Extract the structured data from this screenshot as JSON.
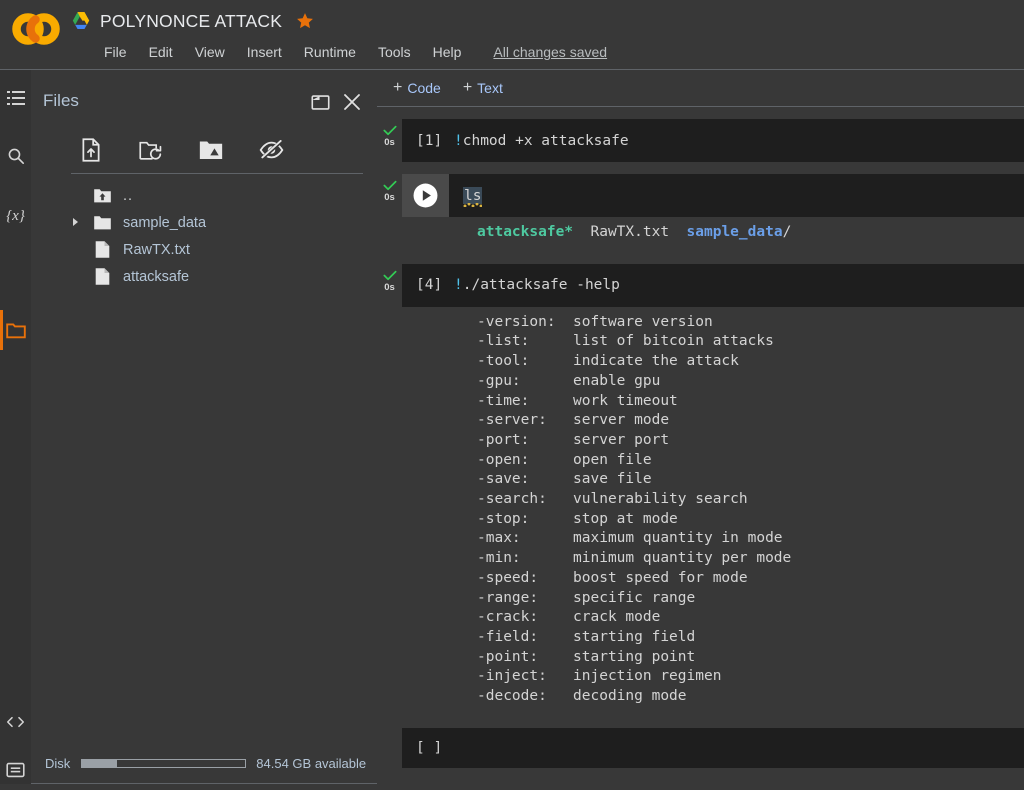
{
  "app": {
    "logo_icon": "colab-co-logo",
    "drive_icon": "google-drive-icon",
    "star_icon": "star-icon",
    "notebook_title": "POLYNONCE ATTACK",
    "save_status": "All changes saved"
  },
  "menubar": {
    "items": [
      {
        "label": "File"
      },
      {
        "label": "Edit"
      },
      {
        "label": "View"
      },
      {
        "label": "Insert"
      },
      {
        "label": "Runtime"
      },
      {
        "label": "Tools"
      },
      {
        "label": "Help"
      }
    ]
  },
  "rail": {
    "items": [
      {
        "name": "table-of-contents-icon",
        "active": false
      },
      {
        "name": "search-icon",
        "active": false
      },
      {
        "name": "variables-icon",
        "active": false,
        "glyph": "{x}"
      },
      {
        "name": "files-folder-icon",
        "active": true
      }
    ],
    "bottom_items": [
      {
        "name": "code-snippets-icon"
      },
      {
        "name": "terminal-icon"
      }
    ],
    "active_color": "#e8710a"
  },
  "files_panel": {
    "title": "Files",
    "popout_button": "open-in-new-window",
    "close_button": "close-panel",
    "toolbar": [
      {
        "name": "upload-file-icon",
        "tooltip": "Upload to session storage"
      },
      {
        "name": "refresh-folder-icon",
        "tooltip": "Refresh"
      },
      {
        "name": "mount-drive-icon",
        "tooltip": "Mount Drive"
      },
      {
        "name": "toggle-hidden-files-icon",
        "tooltip": "Show hidden files"
      }
    ],
    "entries": [
      {
        "label": "..",
        "kind": "parent",
        "icon": "folder-up-icon",
        "expandable": false
      },
      {
        "label": "sample_data",
        "kind": "folder",
        "icon": "folder-icon",
        "expandable": true
      },
      {
        "label": "RawTX.txt",
        "kind": "file",
        "icon": "file-icon",
        "expandable": false
      },
      {
        "label": "attacksafe",
        "kind": "file",
        "icon": "file-icon",
        "expandable": false
      }
    ],
    "disk": {
      "label": "Disk",
      "available_text": "84.54 GB available",
      "used_percent": 21
    }
  },
  "notebook": {
    "toolbar": {
      "add_code_label": "Code",
      "add_text_label": "Text",
      "plus": "+"
    },
    "cells": [
      {
        "exec_count": "[1]",
        "status_icon": "check-icon",
        "runtime": "0s",
        "code_prefix": "!",
        "code": "chmod +x attacksafe",
        "has_run_button": false,
        "selected": false,
        "output_lines": []
      },
      {
        "exec_count": "",
        "status_icon": "check-icon",
        "runtime": "0s",
        "code_prefix": "",
        "code": "ls",
        "has_run_button": true,
        "selected": true,
        "output_lines": [
          {
            "segments": [
              {
                "text": "attacksafe*",
                "style": "green"
              },
              {
                "text": "  RawTX.txt  ",
                "style": "plain"
              },
              {
                "text": "sample_data",
                "style": "blue"
              },
              {
                "text": "/",
                "style": "plain"
              }
            ]
          }
        ]
      },
      {
        "exec_count": "[4]",
        "status_icon": "check-icon",
        "runtime": "0s",
        "code_prefix": "!",
        "code": "./attacksafe -help",
        "has_run_button": false,
        "selected": false,
        "output_lines": [
          {
            "segments": [
              {
                "text": "-version:  software version",
                "style": "plain"
              }
            ]
          },
          {
            "segments": [
              {
                "text": "-list:     list of bitcoin attacks",
                "style": "plain"
              }
            ]
          },
          {
            "segments": [
              {
                "text": "-tool:     indicate the attack",
                "style": "plain"
              }
            ]
          },
          {
            "segments": [
              {
                "text": "-gpu:      enable gpu",
                "style": "plain"
              }
            ]
          },
          {
            "segments": [
              {
                "text": "-time:     work timeout",
                "style": "plain"
              }
            ]
          },
          {
            "segments": [
              {
                "text": "-server:   server mode",
                "style": "plain"
              }
            ]
          },
          {
            "segments": [
              {
                "text": "-port:     server port",
                "style": "plain"
              }
            ]
          },
          {
            "segments": [
              {
                "text": "-open:     open file",
                "style": "plain"
              }
            ]
          },
          {
            "segments": [
              {
                "text": "-save:     save file",
                "style": "plain"
              }
            ]
          },
          {
            "segments": [
              {
                "text": "-search:   vulnerability search",
                "style": "plain"
              }
            ]
          },
          {
            "segments": [
              {
                "text": "-stop:     stop at mode",
                "style": "plain"
              }
            ]
          },
          {
            "segments": [
              {
                "text": "-max:      maximum quantity in mode",
                "style": "plain"
              }
            ]
          },
          {
            "segments": [
              {
                "text": "-min:      minimum quantity per mode",
                "style": "plain"
              }
            ]
          },
          {
            "segments": [
              {
                "text": "-speed:    boost speed for mode",
                "style": "plain"
              }
            ]
          },
          {
            "segments": [
              {
                "text": "-range:    specific range",
                "style": "plain"
              }
            ]
          },
          {
            "segments": [
              {
                "text": "-crack:    crack mode",
                "style": "plain"
              }
            ]
          },
          {
            "segments": [
              {
                "text": "-field:    starting field",
                "style": "plain"
              }
            ]
          },
          {
            "segments": [
              {
                "text": "-point:    starting point",
                "style": "plain"
              }
            ]
          },
          {
            "segments": [
              {
                "text": "-inject:   injection regimen",
                "style": "plain"
              }
            ]
          },
          {
            "segments": [
              {
                "text": "-decode:   decoding mode",
                "style": "plain"
              }
            ]
          }
        ]
      },
      {
        "exec_count": "[ ]",
        "status_icon": "none",
        "runtime": "",
        "code_prefix": "",
        "code": "",
        "has_run_button": false,
        "selected": false,
        "output_lines": []
      }
    ]
  }
}
